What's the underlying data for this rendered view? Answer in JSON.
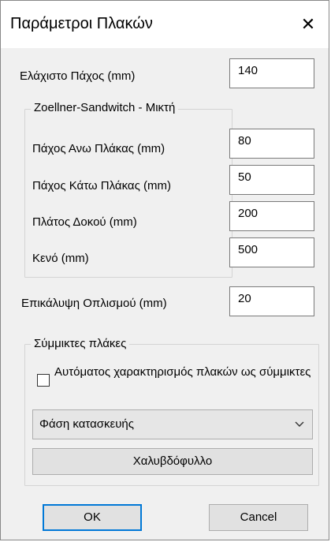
{
  "dialog": {
    "title": "Παράμετροι Πλακών",
    "close_symbol": "✕"
  },
  "min_thickness": {
    "label": "Ελάχιστο Πάχος (mm)",
    "value": "140"
  },
  "zoellner": {
    "group_title": "Zoellner-Sandwitch - Μικτή",
    "top_slab": {
      "label": "Πάχος Ανω Πλάκας (mm)",
      "value": "80"
    },
    "bottom_slab": {
      "label": "Πάχος Κάτω Πλάκας (mm)",
      "value": "50"
    },
    "beam_width": {
      "label": "Πλάτος Δοκού (mm)",
      "value": "200"
    },
    "void": {
      "label": "Κενό (mm)",
      "value": "500"
    }
  },
  "cover": {
    "label": "Επικάλυψη Οπλισμού (mm)",
    "value": "20"
  },
  "composite": {
    "group_title": "Σύμμικτες πλάκες",
    "auto_checkbox_label": "Αυτόματος χαρακτηρισμός πλακών ως σύμμικτες",
    "auto_checked": false,
    "phase_selected": "Φάση κατασκευής",
    "steel_deck_button": "Χαλυβδόφυλλο"
  },
  "buttons": {
    "ok": "OK",
    "cancel": "Cancel"
  },
  "colors": {
    "accent": "#0078d7",
    "dialog_bg": "#f0f0f0"
  },
  "icons": {
    "close": "close-icon",
    "dropdown": "chevron-down-icon"
  }
}
